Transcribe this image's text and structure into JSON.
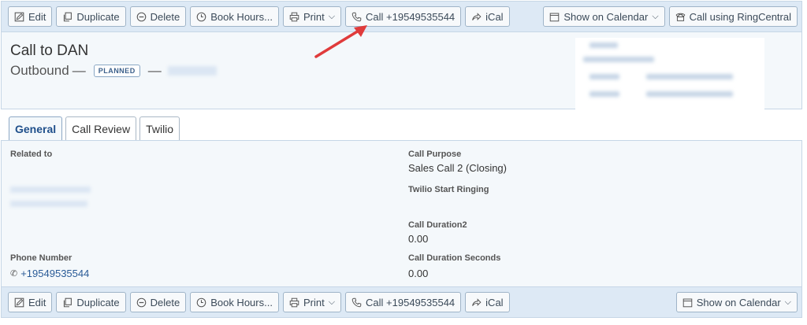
{
  "toolbar_top": {
    "edit": "Edit",
    "duplicate": "Duplicate",
    "delete": "Delete",
    "book_hours": "Book Hours...",
    "print": "Print",
    "call": "Call +19549535544",
    "ical": "iCal",
    "show_on_calendar": "Show on Calendar",
    "call_ringcentral": "Call using RingCentral"
  },
  "toolbar_bottom": {
    "edit": "Edit",
    "duplicate": "Duplicate",
    "delete": "Delete",
    "book_hours": "Book Hours...",
    "print": "Print",
    "call": "Call +19549535544",
    "ical": "iCal",
    "show_on_calendar": "Show on Calendar"
  },
  "header": {
    "title": "Call to DAN",
    "direction": "Outbound",
    "dash": "—",
    "status": "PLANNED"
  },
  "tabs": [
    "General",
    "Call Review",
    "Twilio"
  ],
  "fields": {
    "related_to_label": "Related to",
    "phone_label": "Phone Number",
    "phone_value": "+19549535544",
    "call_purpose_label": "Call Purpose",
    "call_purpose_value": "Sales Call 2 (Closing)",
    "twilio_start_label": "Twilio Start Ringing",
    "duration2_label": "Call Duration2",
    "duration2_value": "0.00",
    "duration_seconds_label": "Call Duration Seconds",
    "duration_seconds_value": "0.00"
  },
  "colors": {
    "toolbar_bg": "#dde9f5",
    "panel_bg": "#f4f8fb",
    "link": "#2a5b97",
    "arrow": "#e03b3b"
  }
}
